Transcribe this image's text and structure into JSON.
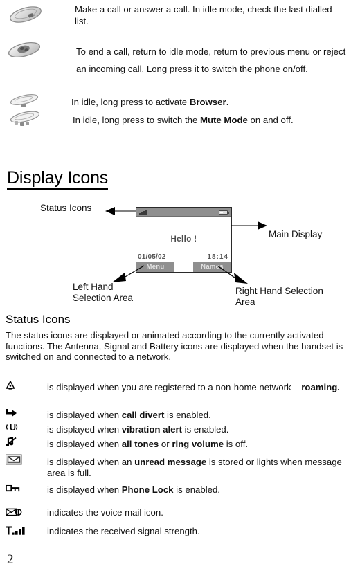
{
  "document": {
    "page_number": "2"
  },
  "key_descriptions": [
    {
      "icon": "send-call-key-icon",
      "text_html": "Make a call or answer a call. In idle mode, check the last dialled list."
    },
    {
      "icon": "end-power-key-icon",
      "text_html": "To end a call, return to idle mode, return to previous menu or reject an incoming call. Long press it to switch the phone on/off."
    },
    {
      "icon": "zero-browser-key-icon",
      "text_html": "In idle, long press to activate <b>Browser</b>."
    },
    {
      "icon": "hash-mute-key-icon",
      "text_html": "In idle, long press to switch the <b>Mute Mode</b> on and off."
    }
  ],
  "display_icons": {
    "heading": "Display Icons",
    "callouts": {
      "status_icons": "Status Icons",
      "main_display": "Main Display",
      "left_hand_line1": "Left Hand",
      "left_hand_line2": "Selection  Area",
      "right_hand_line1": "Right Hand Selection",
      "right_hand_line2": "Area"
    },
    "phone_screen": {
      "greeting": "Hello !",
      "date": "01/05/02",
      "time": "18:14",
      "softkey_left": "Menu",
      "softkey_right": "Names",
      "statusbar_signal_icon": "signal-strength-icon",
      "statusbar_battery_icon": "battery-icon"
    }
  },
  "status_icons_section": {
    "heading": "Status Icons",
    "intro": "The status icons are displayed or animated according to the currently activated functions. The Antenna, Signal and Battery icons are displayed when the handset is switched on and connected to a network.",
    "rows": [
      {
        "icon": "roaming-icon",
        "text_html": "is displayed when you are registered to a non-home network – <b>roaming.</b>"
      },
      {
        "icon": "call-divert-icon",
        "text_html": "is displayed when <b>call divert</b> is enabled."
      },
      {
        "icon": "vibration-alert-icon",
        "text_html": "is displayed when <b>vibration alert</b> is enabled."
      },
      {
        "icon": "mute-tones-icon",
        "text_html": "is displayed when <b>all tones</b> or <b>ring volume</b> is off."
      },
      {
        "icon": "unread-message-icon",
        "text_html": "is displayed when an <b>unread message</b> is stored or lights when message area is full."
      },
      {
        "icon": "phone-lock-icon",
        "text_html": "is displayed when <b>Phone Lock</b> is enabled."
      },
      {
        "icon": "voice-mail-icon",
        "text_html": "indicates the voice mail icon."
      },
      {
        "icon": "signal-strength-icon",
        "text_html": "indicates the received signal strength."
      }
    ]
  },
  "colors": {
    "text": "#111111",
    "screen_chrome": "#8f8f8f",
    "screen_text": "#4a4a4a",
    "rule": "#000000"
  }
}
